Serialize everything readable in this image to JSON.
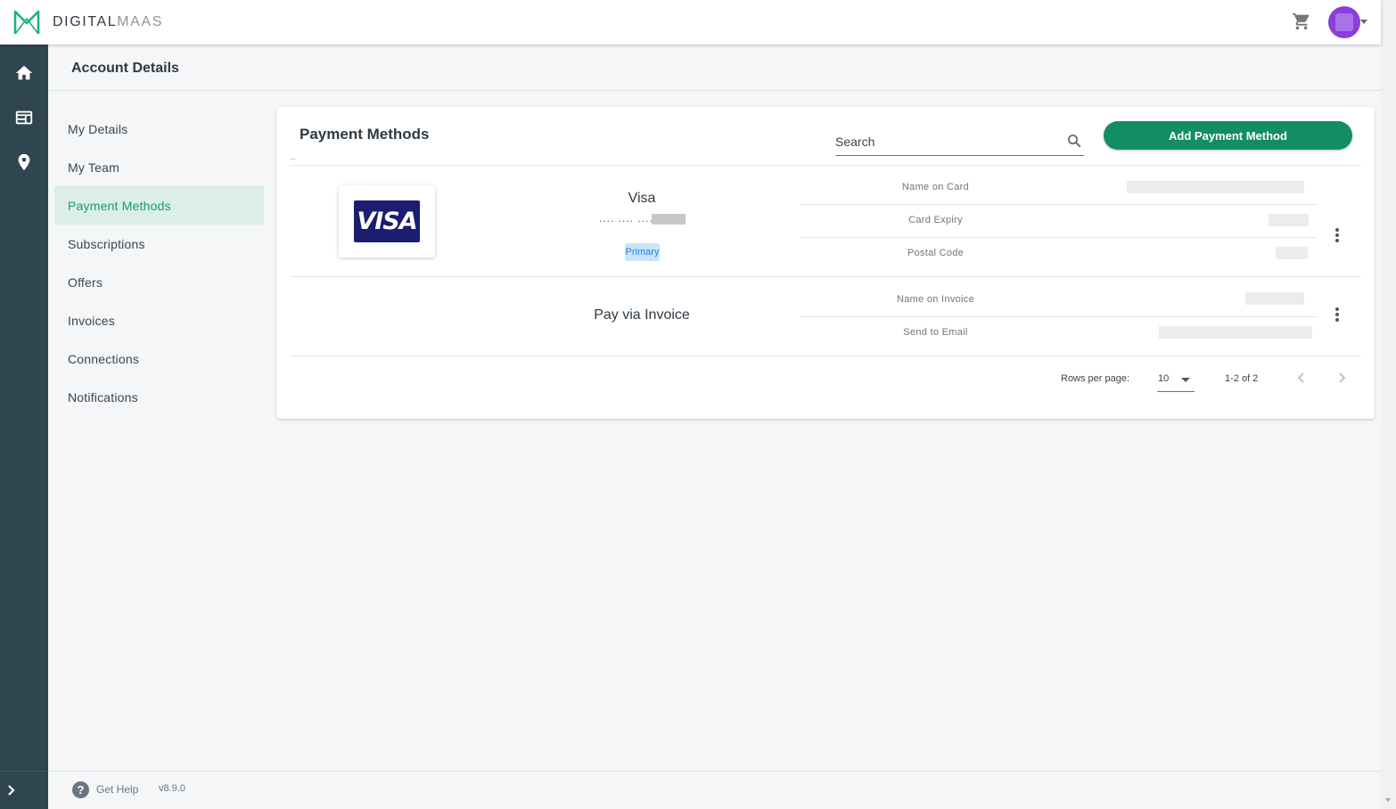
{
  "header": {
    "brand_bold": "DIGITAL",
    "brand_light": "MAAS",
    "brand_color": "#1ab386",
    "cart_icon": "shopping-cart-icon",
    "avatar_color": "#8b3ed8"
  },
  "rail": {
    "icons": [
      "home-icon",
      "dashboard-card-icon",
      "location-pin-icon"
    ],
    "expand_icon": "chevron-right-icon",
    "background": "#2f4550"
  },
  "page": {
    "title": "Account Details"
  },
  "side_nav": {
    "items": [
      {
        "label": "My Details"
      },
      {
        "label": "My Team"
      },
      {
        "label": "Payment Methods",
        "active": true
      },
      {
        "label": "Subscriptions"
      },
      {
        "label": "Offers"
      },
      {
        "label": "Invoices"
      },
      {
        "label": "Connections"
      },
      {
        "label": "Notifications"
      }
    ],
    "active_color": "#1c9a6c"
  },
  "card": {
    "title": "Payment Methods",
    "search_placeholder": "Search",
    "add_button_label": "Add Payment Method",
    "add_button_color": "#138e64",
    "methods": [
      {
        "name": "Visa",
        "logo_text": "VISA",
        "masked_number": ".... .... ....",
        "badge": "Primary",
        "fields": [
          {
            "label": "Name on Card"
          },
          {
            "label": "Card Expiry"
          },
          {
            "label": "Postal Code"
          }
        ]
      },
      {
        "name": "Pay via Invoice",
        "fields": [
          {
            "label": "Name on Invoice"
          },
          {
            "label": "Send to Email"
          }
        ]
      }
    ],
    "pagination": {
      "rows_per_page_label": "Rows per page:",
      "rows_per_page_value": "10",
      "range_label": "1-2 of 2"
    }
  },
  "footer": {
    "help_label": "Get Help",
    "version": "v8.9.0"
  }
}
